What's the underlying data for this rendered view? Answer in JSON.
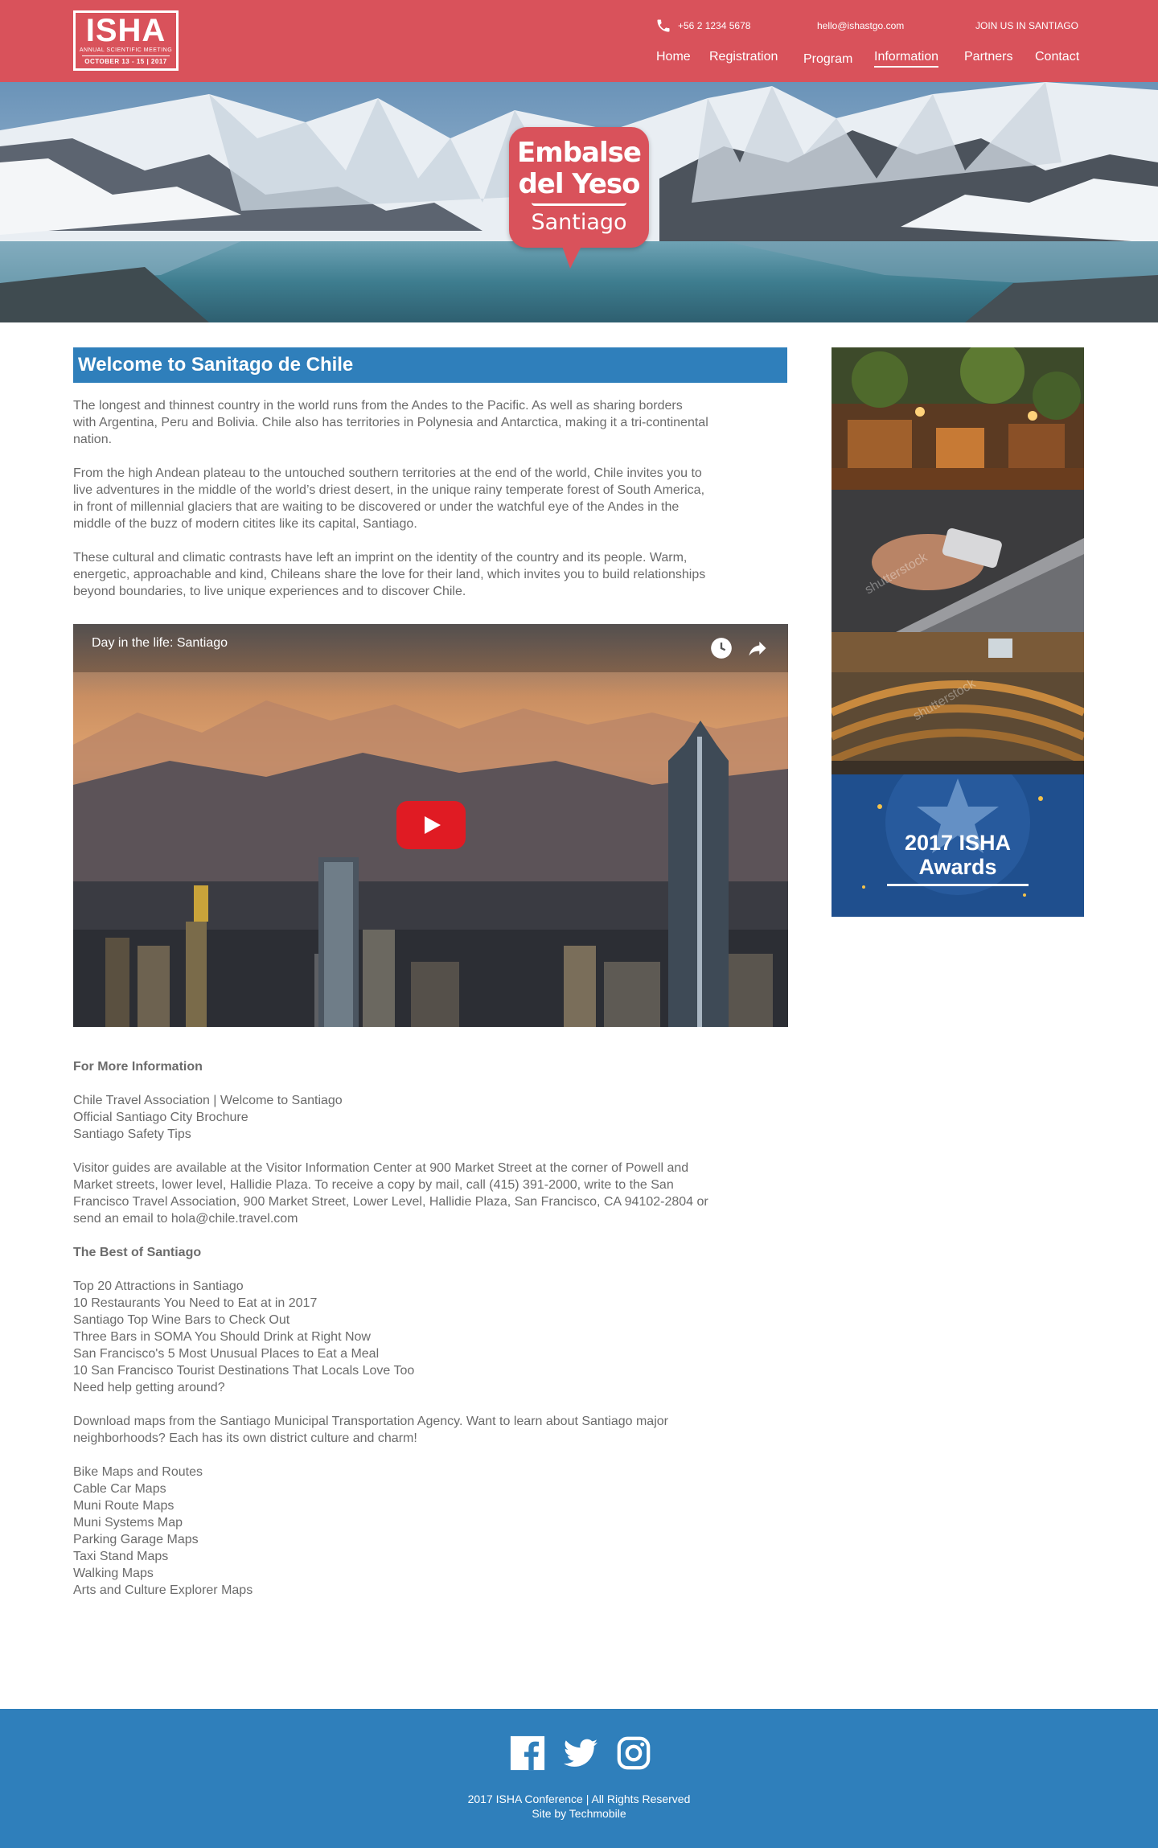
{
  "header": {
    "logo": {
      "title": "ISHA",
      "subtitle": "ANNUAL SCIENTIFIC MEETING",
      "dates": "OCTOBER 13 - 15 | 2017"
    },
    "phone": "+56 2 1234 5678",
    "email": "hello@ishastgo.com",
    "join": "JOIN US IN SANTIAGO",
    "nav": [
      "Home",
      "Registration",
      "Program",
      "Information",
      "Partners",
      "Contact"
    ],
    "active_nav": "Information"
  },
  "hero": {
    "badge_line1": "Embalse",
    "badge_line2": "del Yeso",
    "badge_line3": "Santiago"
  },
  "main": {
    "heading": "Welcome to Sanitago de Chile",
    "paragraphs": [
      [
        "The longest and thinnest country in the world runs from the Andes to the Pacific. As well as sharing borders",
        "with Argentina, Peru and Bolivia. Chile also has territories in Polynesia and Antarctica, making it a tri-continental",
        "nation."
      ],
      [
        "From the high Andean plateau to the untouched southern territories at the end of the world, Chile invites you to",
        "live adventures in the middle of the world’s driest desert, in the unique rainy temperate forest of South America,",
        "in front of millennial glaciers that are waiting to be discovered or under the watchful eye of the Andes in the",
        "middle of the buzz of modern citites like its capital, Santiago."
      ],
      [
        "These cultural and climatic contrasts have left an imprint on the identity of the country and its people. Warm,",
        "energetic, approachable and kind, Chileans share the love for their land, which invites you to build relationships",
        "beyond boundaries, to live unique experiences and to discover Chile."
      ]
    ],
    "video_title": "Day in the life: Santiago",
    "more_info_heading": "For More Information",
    "more_info_links": [
      "Chile Travel Association | Welcome to Santiago",
      "Official Santiago City Brochure",
      "Santiago Safety Tips"
    ],
    "visitor_text": [
      "Visitor guides are available at the Visitor Information Center at 900 Market Street at the corner of Powell and",
      "Market streets, lower level, Hallidie Plaza. To receive a copy by mail, call (415) 391-2000, write to the San",
      "Francisco Travel Association, 900 Market Street, Lower Level, Hallidie Plaza, San Francisco, CA 94102-2804 or",
      "send an email to hola@chile.travel.com"
    ],
    "best_heading": "The Best of Santiago",
    "best_links": [
      "Top 20 Attractions in Santiago",
      "10 Restaurants You Need to Eat at in 2017",
      "Santiago Top Wine Bars to Check Out",
      "Three Bars in SOMA You Should Drink at Right Now",
      "San Francisco's 5 Most Unusual Places to Eat a Meal",
      "10 San Francisco Tourist Destinations That Locals Love Too",
      "Need help getting around?"
    ],
    "maps_text": [
      "Download maps from the Santiago Municipal Transportation Agency. Want to learn about Santiago major",
      "neighborhoods? Each has its own district culture and charm!"
    ],
    "map_links": [
      "Bike Maps and Routes",
      "Cable Car Maps",
      "Muni Route Maps",
      "Muni Systems Map",
      "Parking Garage Maps",
      "Taxi Stand Maps",
      "Walking Maps",
      "Arts and Culture Explorer Maps"
    ]
  },
  "sidebar": {
    "watermark": "shutterstock",
    "awards_line1": "2017 ISHA",
    "awards_line2": "Awards"
  },
  "footer": {
    "copyright": "2017 ISHA Conference | All Rights Reserved",
    "credit": "Site by Techmobile",
    "social_icons": [
      "facebook-icon",
      "twitter-icon",
      "instagram-icon"
    ]
  },
  "colors": {
    "brand_red": "#d9525b",
    "brand_blue": "#2f7fbb",
    "body_text": "#6b6b6b",
    "play_red": "#e01b23"
  }
}
